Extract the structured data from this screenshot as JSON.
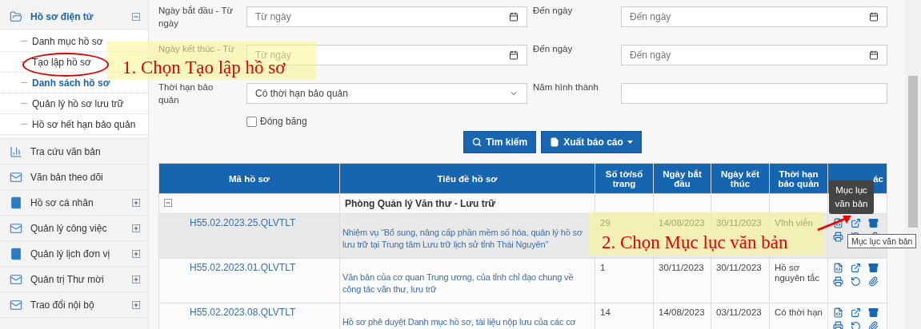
{
  "sidebar": {
    "items": [
      {
        "label": "Hồ sơ điện tử",
        "kind": "folder",
        "active": true,
        "expandable": true,
        "expanded": true,
        "children": [
          {
            "label": "Danh mục hồ sơ",
            "selected": false
          },
          {
            "label": "Tạo lập hồ sơ",
            "selected": false
          },
          {
            "label": "Danh sách hồ sơ",
            "selected": true
          },
          {
            "label": "Quản lý hồ sơ lưu trữ",
            "selected": false
          },
          {
            "label": "Hồ sơ hết hạn bảo quản",
            "selected": false
          }
        ]
      },
      {
        "label": "Tra cứu văn bản",
        "kind": "chart",
        "active": false,
        "expandable": false,
        "expanded": false
      },
      {
        "label": "Văn bản theo dõi",
        "kind": "envelope",
        "active": false,
        "expandable": false,
        "expanded": false
      },
      {
        "label": "Hồ sơ cá nhân",
        "kind": "book",
        "active": false,
        "expandable": true,
        "expanded": false
      },
      {
        "label": "Quản lý công việc",
        "kind": "envelope",
        "active": false,
        "expandable": true,
        "expanded": false
      },
      {
        "label": "Quản lý lịch đơn vị",
        "kind": "book",
        "active": false,
        "expandable": true,
        "expanded": false
      },
      {
        "label": "Quản trị Thư mời",
        "kind": "envelope",
        "active": false,
        "expandable": true,
        "expanded": false
      },
      {
        "label": "Trao đổi nội bộ",
        "kind": "envelope",
        "active": false,
        "expandable": true,
        "expanded": false
      }
    ]
  },
  "filters": {
    "rows": [
      [
        {
          "label": "Ngày bắt đầu - Từ ngày",
          "kind": "date",
          "placeholder": "Từ ngày"
        },
        {
          "label": "Đến ngày",
          "kind": "date",
          "placeholder": "Đến ngày"
        }
      ],
      [
        {
          "label": "Ngày kết thúc - Từ",
          "kind": "date",
          "placeholder": "Từ ngày"
        },
        {
          "label": "Đến ngày",
          "kind": "date",
          "placeholder": "Đến ngày"
        }
      ],
      [
        {
          "label": "Thời hạn bảo quản",
          "kind": "select",
          "value": "Có thời hạn bảo quản"
        },
        {
          "label": "Năm hình thành",
          "kind": "text"
        }
      ]
    ],
    "checkbox": {
      "label": "Đóng băng",
      "checked": false
    },
    "buttons": [
      {
        "label": "Tìm kiếm",
        "kind": "search"
      },
      {
        "label": "Xuất báo cáo",
        "kind": "dropdown"
      }
    ]
  },
  "table": {
    "columns": [
      "Mã hồ sơ",
      "Tiêu đề hồ sơ",
      "Số tờ/số trang",
      "Ngày bắt đầu",
      "Ngày kết thúc",
      "Thời hạn bảo quản",
      "ác"
    ],
    "group": {
      "title": "Phòng Quản lý Văn thư - Lưu trữ",
      "expanded": true
    },
    "rows": [
      {
        "code": "H55.02.2023.25.QLVTLT",
        "title": "Nhiệm vụ “Bổ sung, nâng cấp phần mềm số hóa, quản lý hồ sơ lưu trữ tại Trung tâm Lưu trữ lịch sử tỉnh Thái Nguyên”",
        "pages": "29",
        "start": "14/08/2023",
        "end": "30/11/2023",
        "retention": "Vĩnh viễn",
        "hovered": true
      },
      {
        "code": "H55.02.2023.01.QLVTLT",
        "title": "Văn bản của cơ quan Trung ương, của tỉnh chỉ đạo chung về công tác văn thư, lưu trữ",
        "pages": "1",
        "start": "30/11/2023",
        "end": "30/11/2023",
        "retention": "Hồ sơ nguyên tắc",
        "hovered": false
      },
      {
        "code": "H55.02.2023.08.QLVTLT",
        "title": "Hồ sơ phê duyệt Danh mục hồ sơ, tài liệu nộp lưu của các cơ",
        "pages": "14",
        "start": "14/08/2023",
        "end": "03/11/2023",
        "retention": "Có thời hạn",
        "hovered": false
      }
    ]
  },
  "tooltips": [
    {
      "text": "Mục lục văn bản"
    },
    {
      "text": "Mục lục văn bản"
    }
  ],
  "annotations": [
    {
      "text": "1. Chọn Tạo lập hồ sơ"
    },
    {
      "text": "2. Chọn Mục lục văn bản"
    }
  ]
}
